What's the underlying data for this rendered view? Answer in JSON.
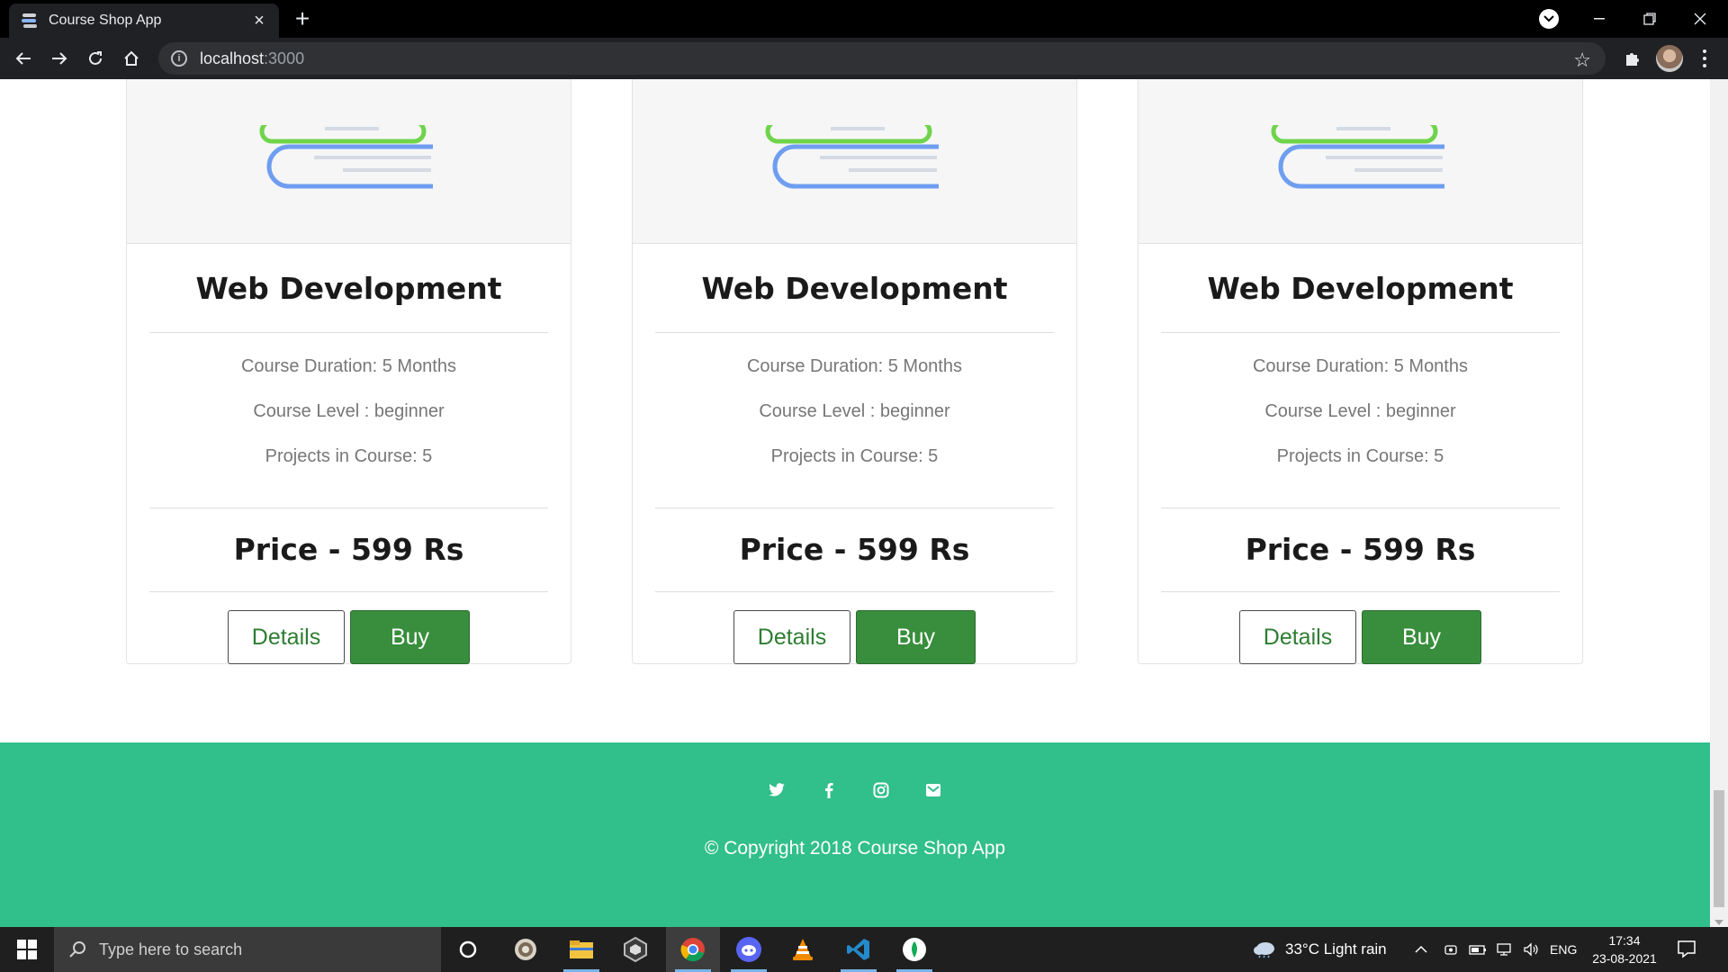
{
  "browser": {
    "tab_title": "Course Shop App",
    "url_host": "localhost",
    "url_port": ":3000"
  },
  "courses": [
    {
      "title": "Web Development",
      "duration": "Course Duration: 5 Months",
      "level": "Course Level : beginner",
      "projects": "Projects in Course: 5",
      "price": "Price - 599 Rs",
      "details_label": "Details",
      "buy_label": "Buy"
    },
    {
      "title": "Web Development",
      "duration": "Course Duration: 5 Months",
      "level": "Course Level : beginner",
      "projects": "Projects in Course: 5",
      "price": "Price - 599 Rs",
      "details_label": "Details",
      "buy_label": "Buy"
    },
    {
      "title": "Web Development",
      "duration": "Course Duration: 5 Months",
      "level": "Course Level : beginner",
      "projects": "Projects in Course: 5",
      "price": "Price - 599 Rs",
      "details_label": "Details",
      "buy_label": "Buy"
    }
  ],
  "footer": {
    "social_icons": [
      "twitter-icon",
      "facebook-icon",
      "instagram-icon",
      "mail-icon"
    ],
    "copyright": "© Copyright 2018 Course Shop App",
    "background": "#31bf8b"
  },
  "colors": {
    "buy_button": "#388e3c",
    "details_text": "#2e7d32"
  },
  "taskbar": {
    "search_placeholder": "Type here to search",
    "apps": [
      "cortana-icon",
      "unknown-app-icon",
      "file-explorer-icon",
      "unity-icon",
      "chrome-icon",
      "discord-icon",
      "vlc-icon",
      "vscode-icon",
      "mongodb-compass-icon"
    ],
    "weather": "33°C  Light rain",
    "language": "ENG",
    "time": "17:34",
    "date": "23-08-2021"
  }
}
